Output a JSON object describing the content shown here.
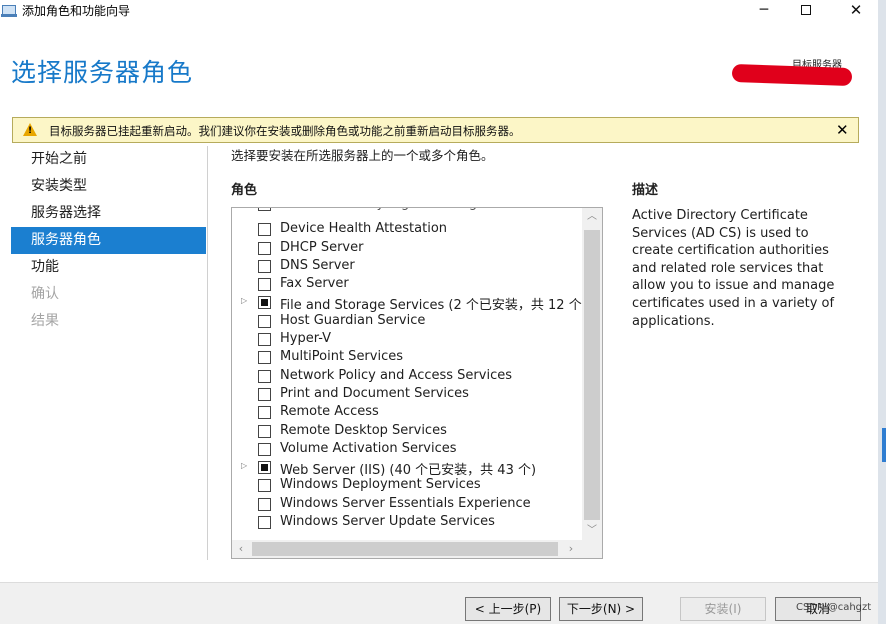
{
  "window": {
    "title": "添加角色和功能向导",
    "minimize": "─",
    "close": "✕"
  },
  "header": {
    "page_title": "选择服务器角色",
    "target_server_label": "目标服务器"
  },
  "warning": {
    "text": "目标服务器已挂起重新启动。我们建议你在安装或删除角色或功能之前重新启动目标服务器。",
    "close": "✕"
  },
  "nav": {
    "items": [
      {
        "label": "开始之前",
        "state": "normal"
      },
      {
        "label": "安装类型",
        "state": "normal"
      },
      {
        "label": "服务器选择",
        "state": "normal"
      },
      {
        "label": "服务器角色",
        "state": "active"
      },
      {
        "label": "功能",
        "state": "normal"
      },
      {
        "label": "确认",
        "state": "disabled"
      },
      {
        "label": "结果",
        "state": "disabled"
      }
    ]
  },
  "main": {
    "instruction": "选择要安装在所选服务器上的一个或多个角色。",
    "roles_heading": "角色",
    "description_heading": "描述",
    "description": "Active Directory Certificate Services (AD CS) is used to create certification authorities and related role services that allow you to issue and manage certificates used in a variety of applications.",
    "roles": [
      {
        "label": "Active Directory Rights Management Services",
        "checked": false,
        "expandable": false,
        "cut": true
      },
      {
        "label": "Device Health Attestation",
        "checked": false,
        "expandable": false
      },
      {
        "label": "DHCP Server",
        "checked": false,
        "expandable": false
      },
      {
        "label": "DNS Server",
        "checked": false,
        "expandable": false
      },
      {
        "label": "Fax Server",
        "checked": false,
        "expandable": false
      },
      {
        "label": "File and Storage Services (2 个已安装，共 12 个)",
        "checked": "partial",
        "expandable": true
      },
      {
        "label": "Host Guardian Service",
        "checked": false,
        "expandable": false
      },
      {
        "label": "Hyper-V",
        "checked": false,
        "expandable": false
      },
      {
        "label": "MultiPoint Services",
        "checked": false,
        "expandable": false
      },
      {
        "label": "Network Policy and Access Services",
        "checked": false,
        "expandable": false
      },
      {
        "label": "Print and Document Services",
        "checked": false,
        "expandable": false
      },
      {
        "label": "Remote Access",
        "checked": false,
        "expandable": false
      },
      {
        "label": "Remote Desktop Services",
        "checked": false,
        "expandable": false
      },
      {
        "label": "Volume Activation Services",
        "checked": false,
        "expandable": false
      },
      {
        "label": "Web Server (IIS) (40 个已安装，共 43 个)",
        "checked": "partial",
        "expandable": true
      },
      {
        "label": "Windows Deployment Services",
        "checked": false,
        "expandable": false
      },
      {
        "label": "Windows Server Essentials Experience",
        "checked": false,
        "expandable": false
      },
      {
        "label": "Windows Server Update Services",
        "checked": false,
        "expandable": false
      }
    ]
  },
  "footer": {
    "prev_label": "< 上一步(P)",
    "next_label": "下一步(N) >",
    "install_label": "安装(I)",
    "cancel_label": "取消",
    "watermark": "CSDN @cahgzt"
  },
  "colors": {
    "accent": "#1b7fd0",
    "title_blue": "#1779c9",
    "warning_bg": "#fcf6c7",
    "redaction": "#e0001b"
  }
}
